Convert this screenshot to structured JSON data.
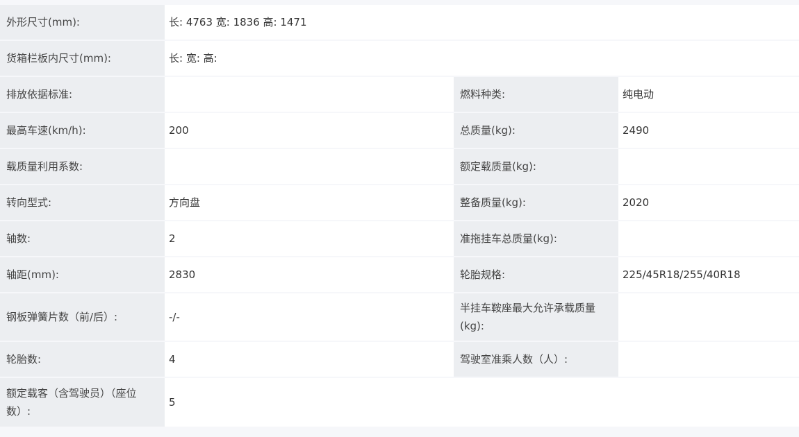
{
  "rows": [
    {
      "label1": "外形尺寸(mm):",
      "value1": "长: 4763 宽: 1836 高: 1471"
    },
    {
      "label1": "货箱栏板内尺寸(mm):",
      "value1": "长:  宽:  高:"
    },
    {
      "label1": "排放依据标准:",
      "value1": "",
      "label2": "燃料种类:",
      "value2": "纯电动"
    },
    {
      "label1": "最高车速(km/h):",
      "value1": "200",
      "label2": "总质量(kg):",
      "value2": "2490"
    },
    {
      "label1": "载质量利用系数:",
      "value1": "",
      "label2": "额定载质量(kg):",
      "value2": ""
    },
    {
      "label1": "转向型式:",
      "value1": "方向盘",
      "label2": "整备质量(kg):",
      "value2": "2020"
    },
    {
      "label1": "轴数:",
      "value1": "2",
      "label2": "准拖挂车总质量(kg):",
      "value2": ""
    },
    {
      "label1": "轴距(mm):",
      "value1": "2830",
      "label2": "轮胎规格:",
      "value2": "225/45R18/255/40R18"
    },
    {
      "label1": "钢板弹簧片数（前/后）:",
      "value1": "-/-",
      "label2": "半挂车鞍座最大允许承载质量(kg):",
      "value2": ""
    },
    {
      "label1": "轮胎数:",
      "value1": "4",
      "label2": "驾驶室准乘人数（人）:",
      "value2": ""
    },
    {
      "label1": "额定载客（含驾驶员）（座位数）:",
      "value1": "5"
    }
  ]
}
